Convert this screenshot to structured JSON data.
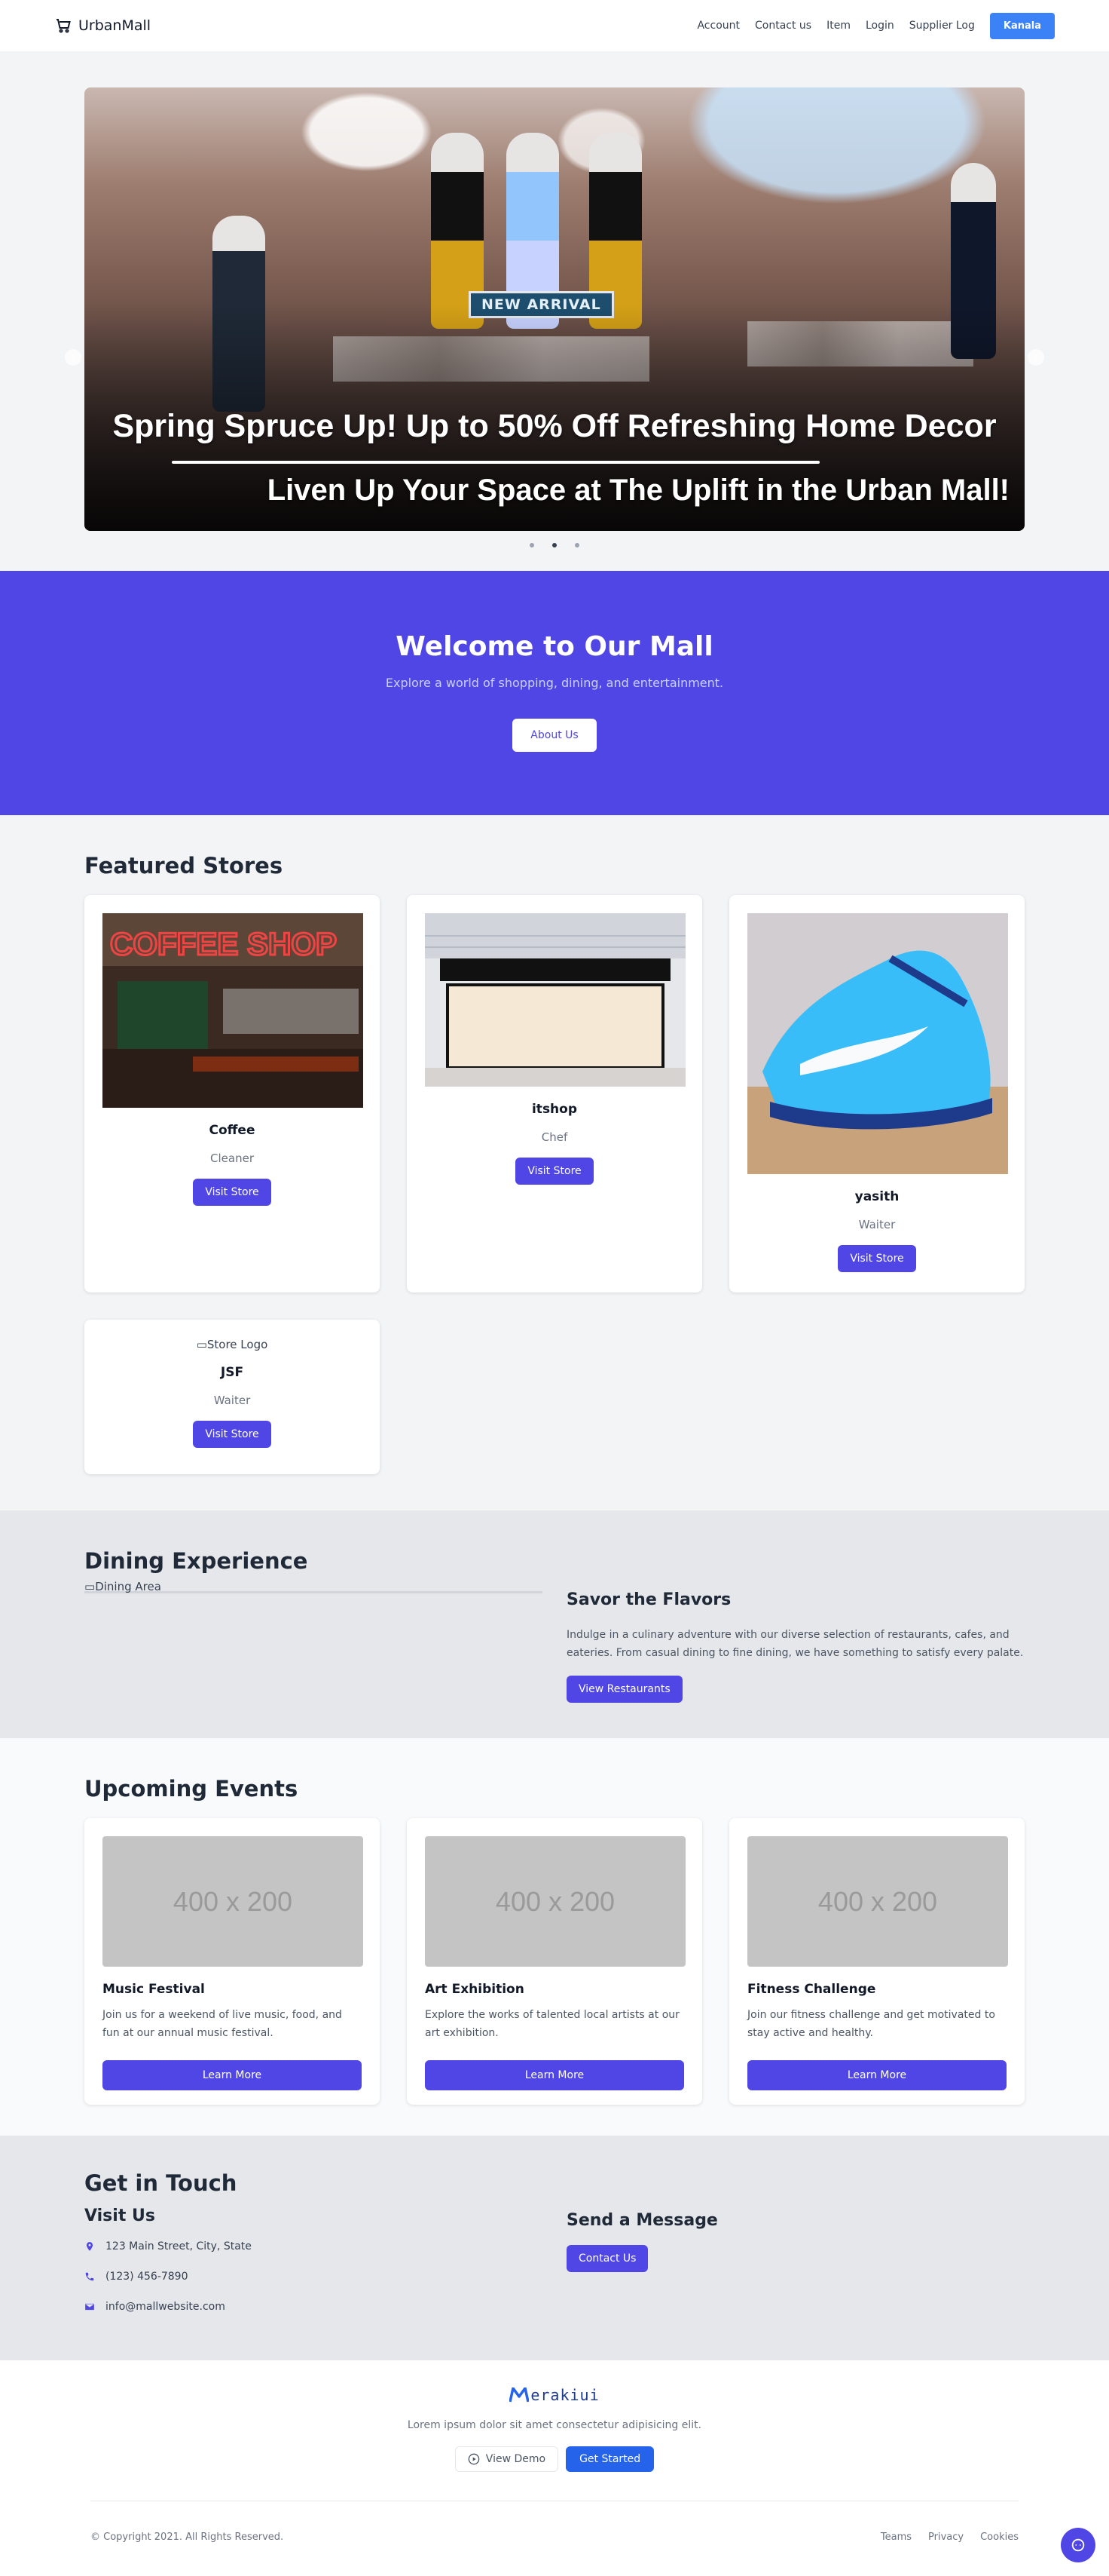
{
  "nav": {
    "brand": "UrbanMall",
    "links": [
      "Account",
      "Contact us",
      "Item",
      "Login",
      "Supplier Log"
    ],
    "cta": "Kanala"
  },
  "hero": {
    "sign": "NEW ARRIVAL",
    "title": "Spring Spruce Up! Up to 50% Off Refreshing Home Decor",
    "subtitle": "Liven Up Your Space at The Uplift in the Urban Mall!",
    "slide_count": 3,
    "active_slide": 2
  },
  "welcome": {
    "title": "Welcome to Our Mall",
    "text": "Explore a world of shopping, dining, and entertainment.",
    "button": "About Us"
  },
  "featured": {
    "title": "Featured Stores",
    "stores": [
      {
        "name": "Coffee",
        "role": "Cleaner",
        "button": "Visit Store",
        "image": "coffee-shop-photo"
      },
      {
        "name": "itshop",
        "role": "Chef",
        "button": "Visit Store",
        "image": "storefront-photo"
      },
      {
        "name": "yasith",
        "role": "Waiter",
        "button": "Visit Store",
        "image": "blue-sneaker-photo"
      },
      {
        "name": "JSF",
        "role": "Waiter",
        "button": "Visit Store",
        "image_alt": "Store Logo"
      }
    ]
  },
  "dining": {
    "title": "Dining Experience",
    "image_alt": "Dining Area",
    "heading": "Savor the Flavors",
    "text": "Indulge in a culinary adventure with our diverse selection of restaurants, cafes, and eateries. From casual dining to fine dining, we have something to satisfy every palate.",
    "button": "View Restaurants"
  },
  "events": {
    "title": "Upcoming Events",
    "placeholder": "400 x 200",
    "items": [
      {
        "title": "Music Festival",
        "text": "Join us for a weekend of live music, food, and fun at our annual music festival.",
        "button": "Learn More"
      },
      {
        "title": "Art Exhibition",
        "text": "Explore the works of talented local artists at our art exhibition.",
        "button": "Learn More"
      },
      {
        "title": "Fitness Challenge",
        "text": "Join our fitness challenge and get motivated to stay active and healthy.",
        "button": "Learn More"
      }
    ]
  },
  "contact": {
    "title": "Get in Touch",
    "visit_title": "Visit Us",
    "address": "123 Main Street, City, State",
    "phone": "(123) 456-7890",
    "email": "info@mallwebsite.com",
    "message_title": "Send a Message",
    "button": "Contact Us"
  },
  "footer": {
    "logo": "erakiui",
    "tagline": "Lorem ipsum dolor sit amet consectetur adipisicing elit.",
    "demo_button": "View Demo",
    "start_button": "Get Started",
    "copyright": "© Copyright 2021. All Rights Reserved.",
    "links": [
      "Teams",
      "Privacy",
      "Cookies"
    ]
  },
  "colors": {
    "primary": "#4f46e5",
    "nav_cta": "#3b82f6",
    "footer_button": "#2563eb"
  }
}
